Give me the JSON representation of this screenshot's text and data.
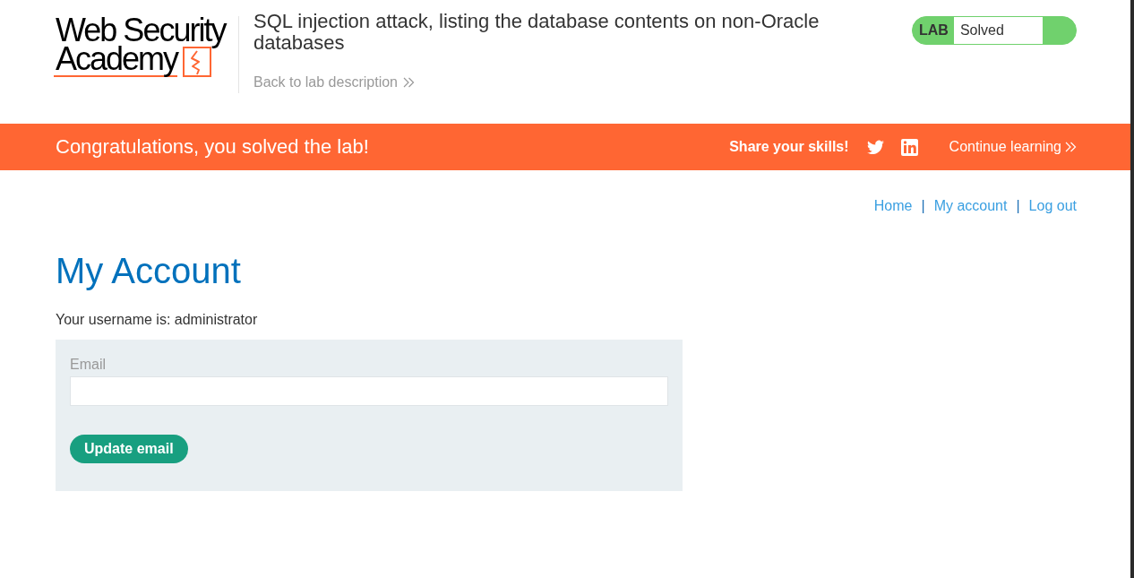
{
  "header": {
    "logo": {
      "line_1": "Web Security",
      "line_2": "Academy"
    },
    "lab_title": "SQL injection attack, listing the database contents on non-Oracle databases",
    "back_link": "Back to lab description",
    "lab_status": {
      "badge": "LAB",
      "status": "Solved",
      "solved": true
    }
  },
  "banner": {
    "message": "Congratulations, you solved the lab!",
    "share_label": "Share your skills!",
    "continue_link": "Continue learning"
  },
  "nav": [
    {
      "kind": "link",
      "label": "Home"
    },
    {
      "kind": "separator",
      "label": "|"
    },
    {
      "kind": "link",
      "label": "My account"
    },
    {
      "kind": "separator",
      "label": "|"
    },
    {
      "kind": "link",
      "label": "Log out"
    }
  ],
  "account": {
    "heading": "My Account",
    "username_text": "Your username is: administrator"
  },
  "email_form": {
    "label": "Email",
    "button": "Update email"
  }
}
